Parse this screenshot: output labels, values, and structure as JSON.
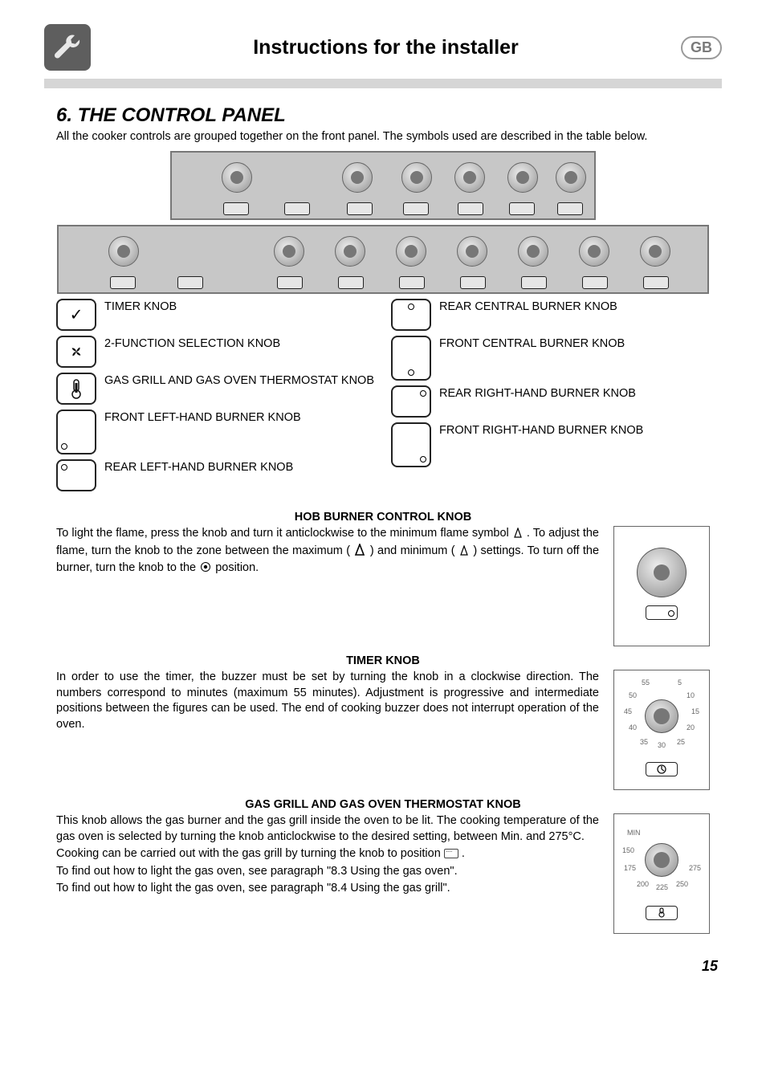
{
  "header": {
    "title": "Instructions for the installer",
    "lang_badge": "GB"
  },
  "section": {
    "title": "6. THE CONTROL PANEL",
    "intro": "All the cooker controls are grouped together on the front panel. The symbols used are described in the table below."
  },
  "legend": {
    "left": [
      {
        "label": "TIMER KNOB",
        "icon": "timer"
      },
      {
        "label": "2-FUNCTION SELECTION KNOB",
        "icon": "fan"
      },
      {
        "label": "GAS GRILL AND GAS OVEN THERMOSTAT KNOB",
        "icon": "thermo"
      },
      {
        "label": "FRONT LEFT-HAND BURNER KNOB",
        "icon": "bl"
      },
      {
        "label": "REAR LEFT-HAND BURNER KNOB",
        "icon": "tl"
      }
    ],
    "right": [
      {
        "label": "REAR CENTRAL BURNER KNOB",
        "icon": "tr2"
      },
      {
        "label": "FRONT CENTRAL BURNER KNOB",
        "icon": "bc"
      },
      {
        "label": "REAR RIGHT-HAND BURNER KNOB",
        "icon": "tr"
      },
      {
        "label": "FRONT RIGHT-HAND BURNER KNOB",
        "icon": "br"
      }
    ]
  },
  "hob": {
    "title": "HOB BURNER CONTROL KNOB",
    "p1a": "To light the flame, press the knob and turn it anticlockwise to the minimum flame symbol ",
    "p1b": ". To adjust the flame, turn the knob to the zone between the maximum (",
    "p1c": ") and minimum (",
    "p1d": ") settings. To turn off the burner, turn the knob to the ",
    "p1e": " position."
  },
  "timer": {
    "title": "TIMER KNOB",
    "body": "In order to use the timer, the buzzer must be set by turning the knob in a clockwise direction.  The numbers correspond to minutes (maximum 55 minutes). Adjustment is progressive and intermediate positions between the figures can be used. The end of cooking buzzer does not interrupt operation of the oven.",
    "ticks": [
      "55",
      "5",
      "50",
      "10",
      "45",
      "15",
      "40",
      "20",
      "35",
      "30",
      "25"
    ]
  },
  "thermostat": {
    "title": "GAS GRILL AND GAS OVEN THERMOSTAT KNOB",
    "p1": "This knob allows the gas burner and the gas grill inside the oven to be lit. The cooking temperature of the gas oven is selected by turning the knob anticlockwise to the desired setting, between Min. and 275°C.",
    "p2a": "Cooking can be carried out with the gas grill by turning the knob to position ",
    "p2b": ".",
    "p3": "To find out how to light the gas oven, see paragraph \"8.3 Using the gas oven\".",
    "p4": "To find out how to light the gas oven, see paragraph \"8.4 Using the gas grill\".",
    "ticks": [
      "MIN",
      "150",
      "175",
      "200",
      "225",
      "250",
      "275"
    ]
  },
  "page_number": "15"
}
